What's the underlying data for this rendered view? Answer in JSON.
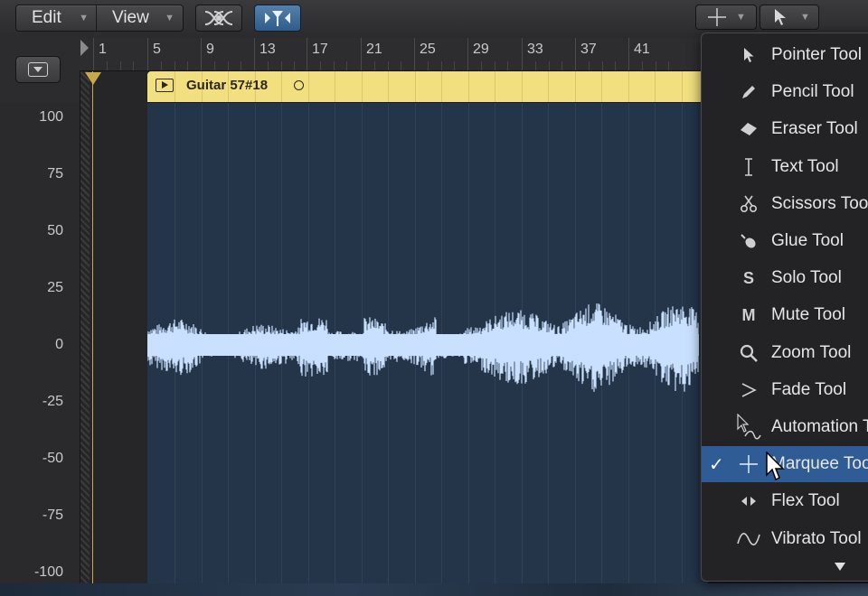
{
  "toolbar": {
    "edit_label": "Edit",
    "view_label": "View",
    "caret": "▼"
  },
  "ruler": {
    "bars": [
      "1",
      "5",
      "9",
      "13",
      "17",
      "21",
      "25",
      "29",
      "33",
      "37",
      "41"
    ]
  },
  "region": {
    "name": "Guitar 57#18"
  },
  "amplitude_axis": {
    "ticks": [
      "100",
      "75",
      "50",
      "25",
      "0",
      "-25",
      "-50",
      "-75",
      "-100"
    ]
  },
  "tool_menu": {
    "items": [
      {
        "label": "Pointer Tool",
        "icon": "pointer-icon",
        "selected": false
      },
      {
        "label": "Pencil Tool",
        "icon": "pencil-icon",
        "selected": false
      },
      {
        "label": "Eraser Tool",
        "icon": "eraser-icon",
        "selected": false
      },
      {
        "label": "Text Tool",
        "icon": "text-cursor-icon",
        "selected": false
      },
      {
        "label": "Scissors Tool",
        "icon": "scissors-icon",
        "selected": false
      },
      {
        "label": "Glue Tool",
        "icon": "glue-icon",
        "selected": false
      },
      {
        "label": "Solo Tool",
        "icon": "solo-icon",
        "selected": false
      },
      {
        "label": "Mute Tool",
        "icon": "mute-icon",
        "selected": false
      },
      {
        "label": "Zoom Tool",
        "icon": "zoom-icon",
        "selected": false
      },
      {
        "label": "Fade Tool",
        "icon": "fade-icon",
        "selected": false
      },
      {
        "label": "Automation Tool",
        "icon": "automation-icon",
        "selected": false
      },
      {
        "label": "Marquee Tool",
        "icon": "marquee-icon",
        "selected": true
      },
      {
        "label": "Flex Tool",
        "icon": "flex-icon",
        "selected": false
      },
      {
        "label": "Vibrato Tool",
        "icon": "vibrato-icon",
        "selected": false
      }
    ],
    "checkmark": "✓",
    "solo_glyph": "S",
    "mute_glyph": "M"
  },
  "colors": {
    "region_header": "#f2df7f",
    "waveform": "#c9e0ff",
    "waveform_bg": "#243449",
    "selection": "#2f5c95",
    "playhead": "#c7a94a"
  }
}
